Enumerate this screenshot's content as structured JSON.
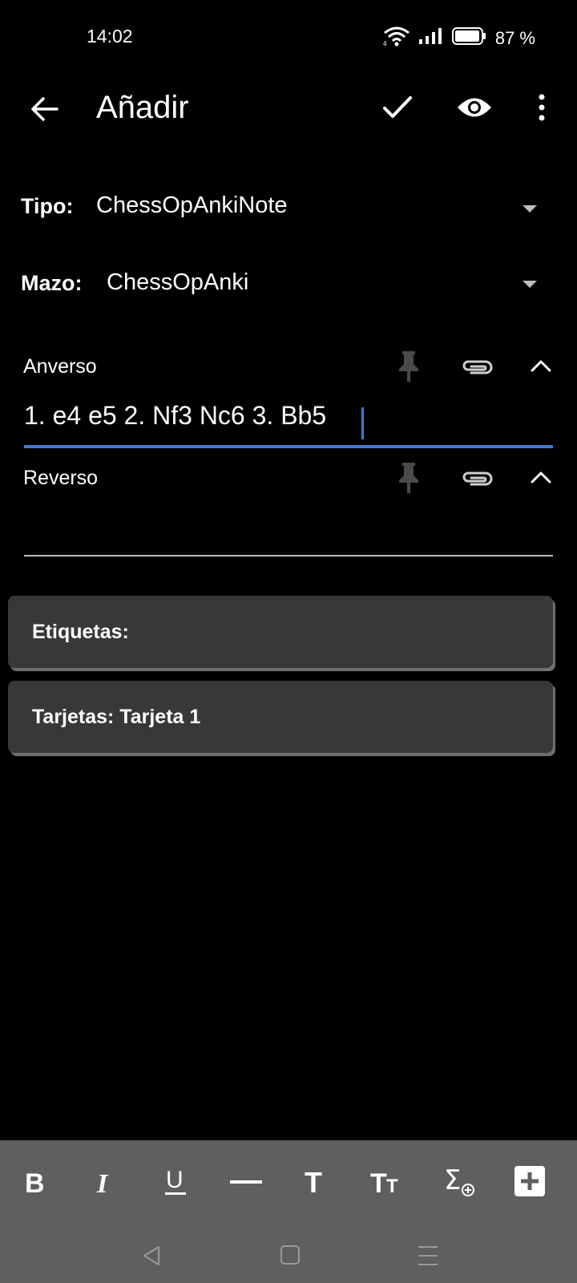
{
  "status_bar": {
    "time": "14:02",
    "battery_percent": "87 %",
    "icons": [
      "wifi-icon",
      "signal-icon",
      "battery-icon"
    ]
  },
  "toolbar": {
    "title": "Añadir",
    "icons": [
      "back-arrow-icon",
      "check-icon",
      "eye-icon",
      "more-vert-icon"
    ]
  },
  "selectors": {
    "tipo": {
      "label": "Tipo:",
      "value": "ChessOpAnkiNote"
    },
    "mazo": {
      "label": "Mazo:",
      "value": "ChessOpAnki"
    }
  },
  "fields": {
    "front": {
      "label": "Anverso",
      "value": "1. e4 e5 2. Nf3 Nc6 3. Bb5"
    },
    "back": {
      "label": "Reverso",
      "value": ""
    }
  },
  "cards": {
    "tags": "Etiquetas:",
    "cards": "Tarjetas: Tarjeta 1"
  },
  "format_bar": {
    "icons": [
      "bold-icon",
      "italic-icon",
      "underline-icon",
      "horizontal-rule-icon",
      "font-size-icon",
      "title-case-icon",
      "math-sigma-icon",
      "add-field-icon"
    ]
  },
  "colors": {
    "background": "#000000",
    "accent": "#3d7bd6",
    "card": "#383838",
    "format_bar": "#5f5f5f"
  }
}
